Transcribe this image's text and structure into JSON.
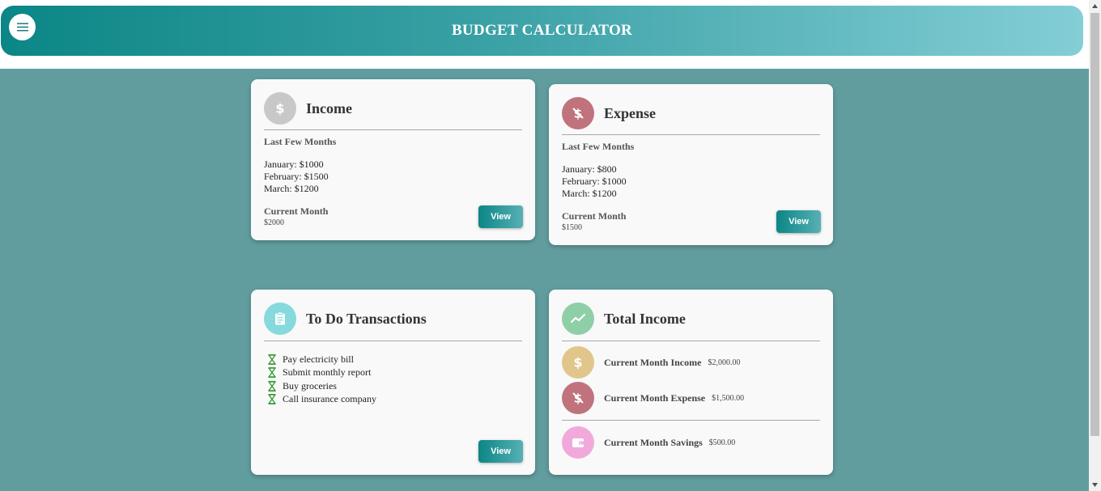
{
  "header": {
    "title": "BUDGET CALCULATOR",
    "menu_icon": "hamburger-menu-icon"
  },
  "colors": {
    "header_gradient_start": "#0b8686",
    "header_gradient_end": "#84ced6",
    "background": "#619d9f",
    "income_icon_bg": "#c8c8c8",
    "expense_icon_bg": "#c0737c",
    "todo_icon_bg": "#86d9dc",
    "total_icon_bg": "#8fcfa7",
    "savings_icon_bg": "#f1a9dc",
    "income_small_icon_bg": "#e0c68a",
    "todo_hourglass": "#3a9a3a"
  },
  "income_card": {
    "title": "Income",
    "icon": "dollar-icon",
    "subheading": "Last Few Months",
    "months": [
      "January: $1000",
      "February: $1500",
      "March: $1200"
    ],
    "current_label": "Current Month",
    "current_value": "$2000",
    "button_label": "View"
  },
  "expense_card": {
    "title": "Expense",
    "icon": "money-off-icon",
    "subheading": "Last Few Months",
    "months": [
      "January: $800",
      "February: $1000",
      "March: $1200"
    ],
    "current_label": "Current Month",
    "current_value": "$1500",
    "button_label": "View"
  },
  "todo_card": {
    "title": "To Do Transactions",
    "icon": "clipboard-icon",
    "items": [
      "Pay electricity bill",
      "Submit monthly report",
      "Buy groceries",
      "Call insurance company"
    ],
    "item_icon": "hourglass-icon",
    "button_label": "View"
  },
  "total_card": {
    "title": "Total Income",
    "icon": "trending-up-icon",
    "rows": [
      {
        "label": "Current Month Income",
        "value": "$2,000.00",
        "icon": "dollar-icon"
      },
      {
        "label": "Current Month Expense",
        "value": "$1,500.00",
        "icon": "money-off-icon"
      },
      {
        "label": "Current Month Savings",
        "value": "$500.00",
        "icon": "wallet-icon"
      }
    ]
  }
}
